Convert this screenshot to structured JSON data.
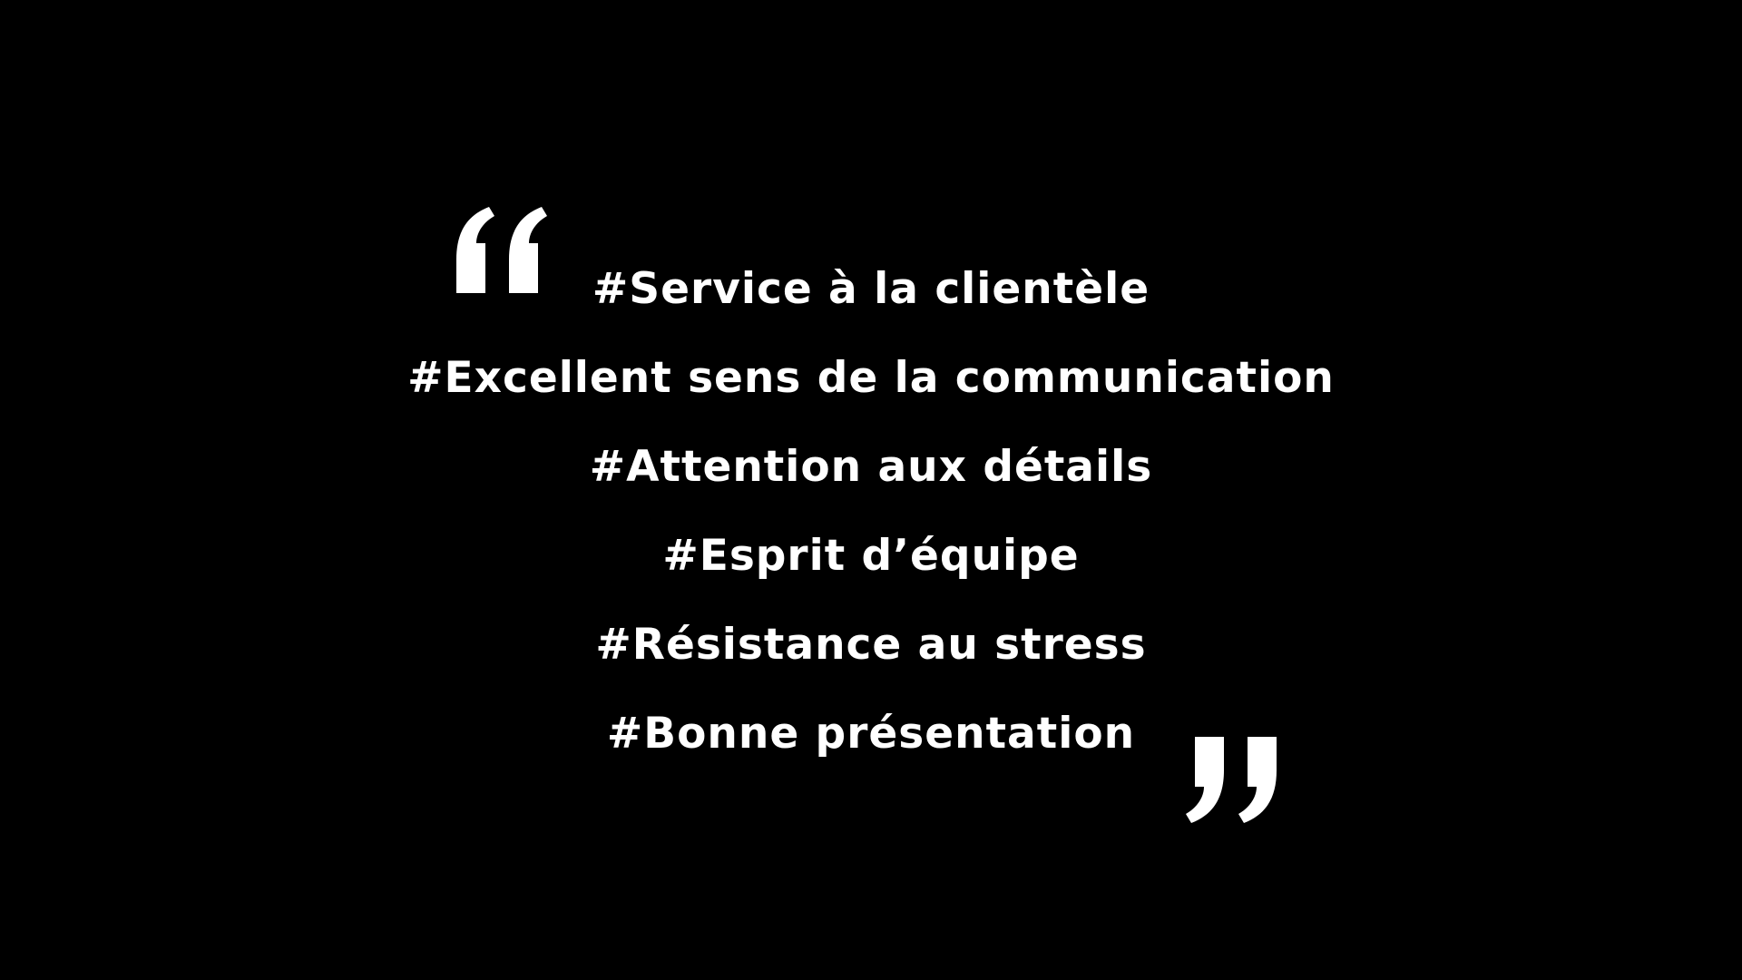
{
  "colors": {
    "background": "#000000",
    "text": "#ffffff"
  },
  "icons": {
    "open_quote": "opening-quotation-mark-icon",
    "close_quote": "closing-quotation-mark-icon"
  },
  "quote": {
    "lines": [
      "#Service à la clientèle",
      "#Excellent sens de la communication",
      "#Attention aux détails",
      "#Esprit d’équipe",
      "#Résistance au stress",
      "#Bonne présentation"
    ]
  }
}
